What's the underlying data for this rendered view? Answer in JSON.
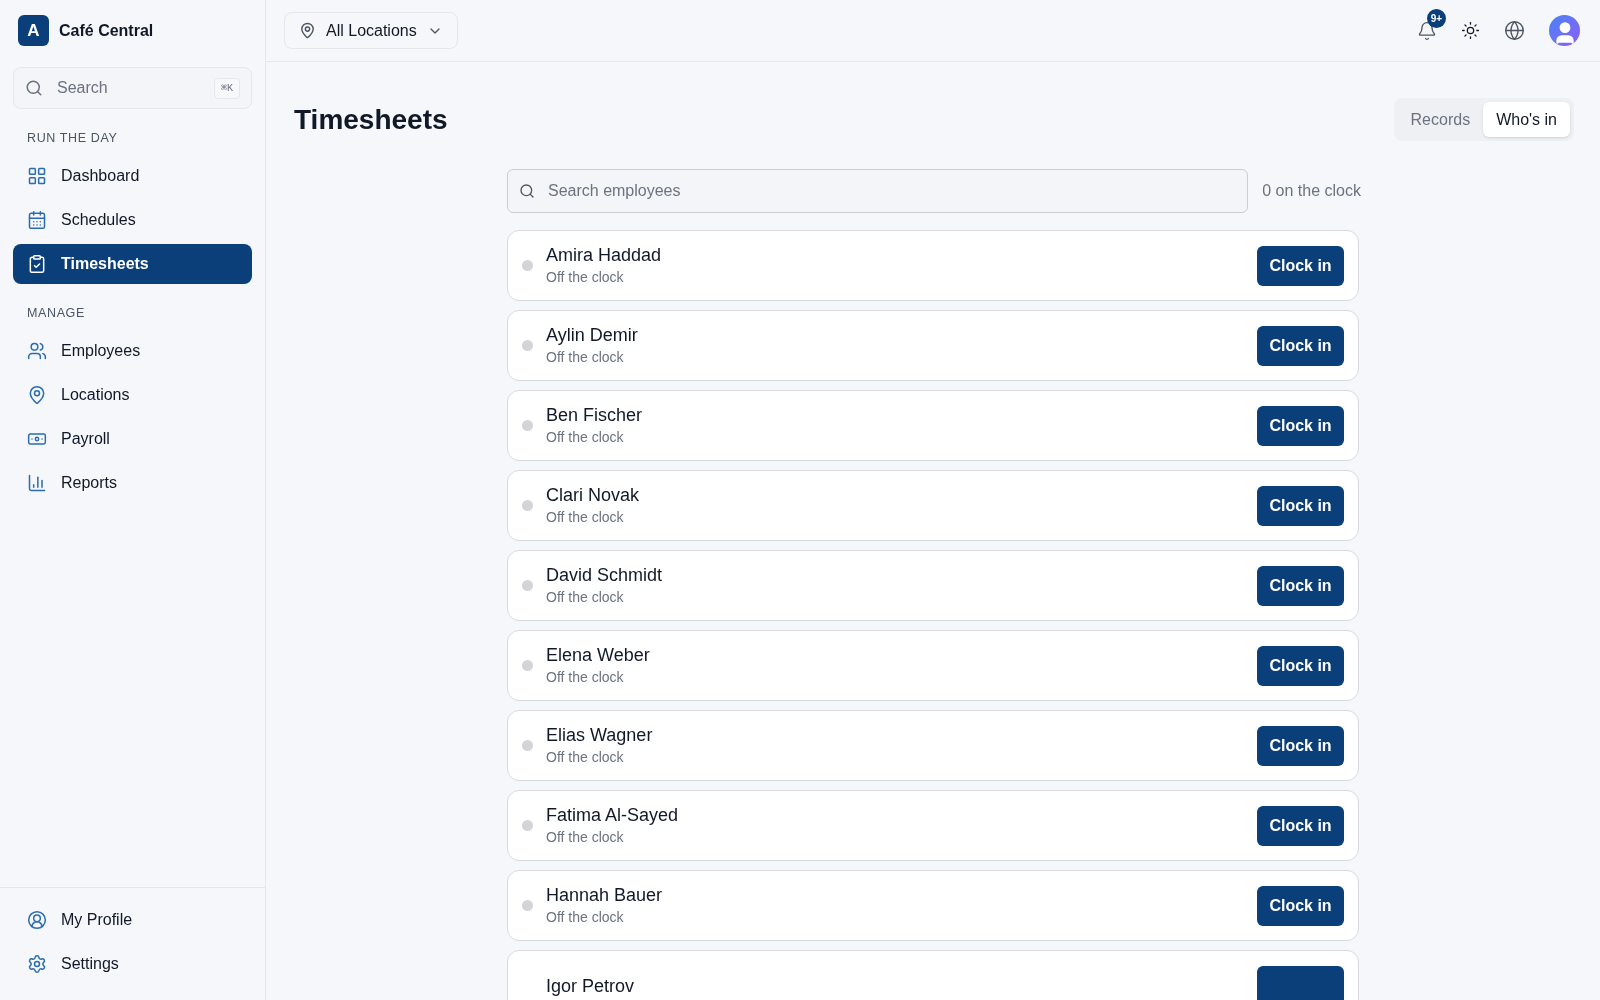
{
  "brand": {
    "initial": "A",
    "name": "Café Central"
  },
  "search": {
    "placeholder": "Search",
    "shortcut": "⌘K"
  },
  "nav_sections": [
    {
      "heading": "RUN THE DAY",
      "items": [
        {
          "label": "Dashboard",
          "selected": false
        },
        {
          "label": "Schedules",
          "selected": false
        },
        {
          "label": "Timesheets",
          "selected": true
        }
      ]
    },
    {
      "heading": "MANAGE",
      "items": [
        {
          "label": "Employees",
          "selected": false
        },
        {
          "label": "Locations",
          "selected": false
        },
        {
          "label": "Payroll",
          "selected": false
        },
        {
          "label": "Reports",
          "selected": false
        }
      ]
    }
  ],
  "footer_nav": [
    {
      "label": "My Profile"
    },
    {
      "label": "Settings"
    }
  ],
  "location_picker": {
    "label": "All Locations"
  },
  "notifications": {
    "badge": "9+"
  },
  "page_title": "Timesheets",
  "tabs": [
    {
      "label": "Records",
      "selected": false
    },
    {
      "label": "Who's in",
      "selected": true
    }
  ],
  "employee_search": {
    "placeholder": "Search employees"
  },
  "clock_count": "0 on the clock",
  "employees": [
    {
      "name": "Amira Haddad",
      "status": "Off the clock",
      "on_clock": false,
      "action": "Clock in"
    },
    {
      "name": "Aylin Demir",
      "status": "Off the clock",
      "on_clock": false,
      "action": "Clock in"
    },
    {
      "name": "Ben Fischer",
      "status": "Off the clock",
      "on_clock": false,
      "action": "Clock in"
    },
    {
      "name": "Clari Novak",
      "status": "Off the clock",
      "on_clock": false,
      "action": "Clock in"
    },
    {
      "name": "David Schmidt",
      "status": "Off the clock",
      "on_clock": false,
      "action": "Clock in"
    },
    {
      "name": "Elena Weber",
      "status": "Off the clock",
      "on_clock": false,
      "action": "Clock in"
    },
    {
      "name": "Elias Wagner",
      "status": "Off the clock",
      "on_clock": false,
      "action": "Clock in"
    },
    {
      "name": "Fatima Al-Sayed",
      "status": "Off the clock",
      "on_clock": false,
      "action": "Clock in"
    },
    {
      "name": "Hannah Bauer",
      "status": "Off the clock",
      "on_clock": false,
      "action": "Clock in"
    },
    {
      "name": "Igor Petrov"
    }
  ]
}
